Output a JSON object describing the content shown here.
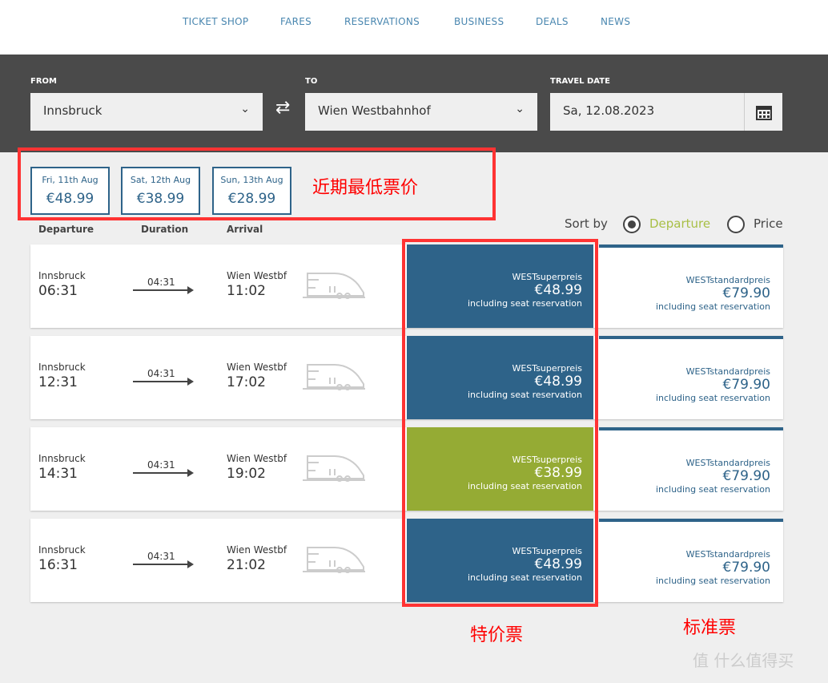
{
  "nav": [
    "TICKET SHOP",
    "FARES",
    "RESERVATIONS",
    "BUSINESS",
    "DEALS",
    "NEWS"
  ],
  "search": {
    "from_label": "FROM",
    "from": "Innsbruck",
    "to_label": "TO",
    "to": "Wien Westbahnhof",
    "date_label": "TRAVEL DATE",
    "date": "Sa, 12.08.2023"
  },
  "days": [
    {
      "date": "Fri, 11th Aug",
      "price": "€48.99"
    },
    {
      "date": "Sat, 12th Aug",
      "price": "€38.99"
    },
    {
      "date": "Sun, 13th Aug",
      "price": "€28.99"
    }
  ],
  "annotations": {
    "lowest": "近期最低票价",
    "special": "特价票",
    "standard": "标准票"
  },
  "columns": {
    "departure": "Departure",
    "duration": "Duration",
    "arrival": "Arrival"
  },
  "sort": {
    "label": "Sort by",
    "options": [
      "Departure",
      "Price"
    ],
    "selected": "Departure"
  },
  "rows": [
    {
      "from": "Innsbruck",
      "dep": "06:31",
      "duration": "04:31",
      "to": "Wien Westbf",
      "arr": "11:02",
      "super_name": "WESTsuperpreis",
      "super_price": "€48.99",
      "super_note": "including seat reservation",
      "super_color": "#2e6389",
      "std_name": "WESTstandardpreis",
      "std_price": "€79.90",
      "std_note": "including seat reservation"
    },
    {
      "from": "Innsbruck",
      "dep": "12:31",
      "duration": "04:31",
      "to": "Wien Westbf",
      "arr": "17:02",
      "super_name": "WESTsuperpreis",
      "super_price": "€48.99",
      "super_note": "including seat reservation",
      "super_color": "#2e6389",
      "std_name": "WESTstandardpreis",
      "std_price": "€79.90",
      "std_note": "including seat reservation"
    },
    {
      "from": "Innsbruck",
      "dep": "14:31",
      "duration": "04:31",
      "to": "Wien Westbf",
      "arr": "19:02",
      "super_name": "WESTsuperpreis",
      "super_price": "€38.99",
      "super_note": "including seat reservation",
      "super_color": "#95ab34",
      "std_name": "WESTstandardpreis",
      "std_price": "€79.90",
      "std_note": "including seat reservation"
    },
    {
      "from": "Innsbruck",
      "dep": "16:31",
      "duration": "04:31",
      "to": "Wien Westbf",
      "arr": "21:02",
      "super_name": "WESTsuperpreis",
      "super_price": "€48.99",
      "super_note": "including seat reservation",
      "super_color": "#2e6389",
      "std_name": "WESTstandardpreis",
      "std_price": "€79.90",
      "std_note": "including seat reservation"
    }
  ],
  "watermark": "值 什么值得买"
}
